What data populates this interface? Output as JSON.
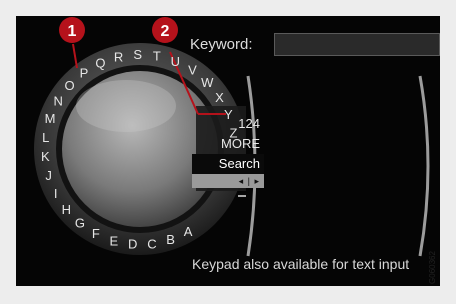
{
  "callouts": [
    {
      "number": "1"
    },
    {
      "number": "2"
    }
  ],
  "keyword": {
    "label": "Keyword:",
    "value": ""
  },
  "dial": {
    "letters": [
      "R",
      "S",
      "T",
      "U",
      "V",
      "W",
      "X",
      "Y",
      "Z",
      "",
      "",
      "",
      "",
      "",
      "A",
      "B",
      "C",
      "D",
      "E",
      "F",
      "G",
      "H",
      "I",
      "J",
      "K",
      "L",
      "M",
      "N",
      "O",
      "P",
      "Q"
    ]
  },
  "options": {
    "numbers": "124",
    "more": "MORE",
    "search": "Search",
    "cursor": "◂ | ▸"
  },
  "hint": "Keypad also available for text input",
  "image_code": "G060362",
  "colors": {
    "callout": "#b5121b",
    "screen": "#050505",
    "highlight": "#9a9a9a"
  }
}
